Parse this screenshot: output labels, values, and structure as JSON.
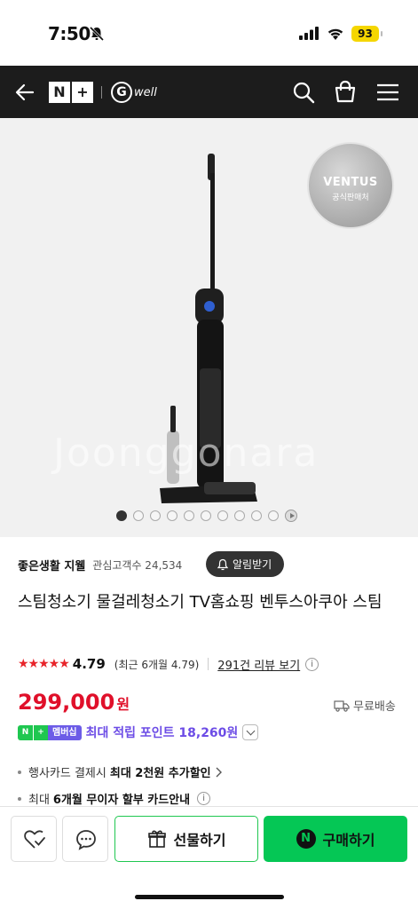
{
  "status_bar": {
    "time": "7:50",
    "battery": "93"
  },
  "nav": {
    "nplus_left": "N",
    "nplus_right": "+",
    "brand_g": "G",
    "brand_text": "well"
  },
  "hero": {
    "badge_title": "VENTUS",
    "badge_sub": "공식판매처",
    "watermark": "Joonggonara",
    "dot_count": 10,
    "active_dot": 0
  },
  "store": {
    "name": "좋은생활 지웰",
    "followers": "관심고객수 24,534",
    "alarm_button": "알림받기"
  },
  "product": {
    "title": "스팀청소기 물걸레청소기 TV홈쇼핑 벤투스아쿠아 스팀"
  },
  "rating": {
    "stars": "★★★★★",
    "score": "4.79",
    "recent": "(최근 6개월 4.79)",
    "reviews": "291건 리뷰 보기",
    "stars_value": 4.79
  },
  "price": {
    "amount": "299,000",
    "unit": "원"
  },
  "shipping": {
    "label": "무료배송"
  },
  "point": {
    "badge_n": "N",
    "badge_plus": "+",
    "badge_member": "멤버십",
    "text": "최대 적립 포인트 18,260원"
  },
  "benefits": {
    "b1_pre": "행사카드 결제시",
    "b1_bold": "최대 2천원 추가할인",
    "b2_pre": "최대",
    "b2_bold": "6개월 무이자 할부 카드안내"
  },
  "bottom_bar": {
    "gift_label": "선물하기",
    "buy_label": "구매하기",
    "buy_logo": "N"
  },
  "colors": {
    "accent_green": "#05c755",
    "price_red": "#e0102a",
    "point_purple": "#6c4ce6",
    "nav_bg": "#1c1c1c"
  }
}
